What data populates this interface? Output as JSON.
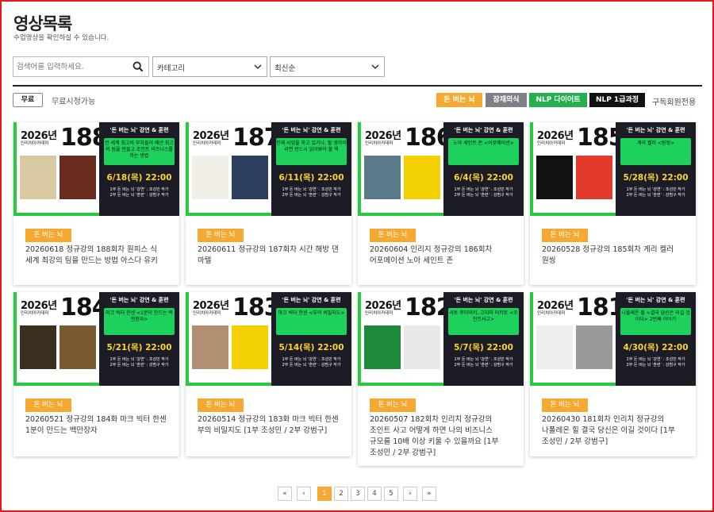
{
  "page": {
    "title": "영상목록",
    "subtitle": "수업영상을 확인하실 수 있습니다."
  },
  "search": {
    "placeholder": "검색어를 입력하세요.",
    "category": "카테고리",
    "sort": "최신순"
  },
  "filters": {
    "free_button": "무료",
    "free_label": "무료시청가능",
    "tags": [
      {
        "label": "돈 버는 뇌",
        "color": "#f5a930"
      },
      {
        "label": "잠재의식",
        "color": "#7d8087"
      },
      {
        "label": "NLP 다이어트",
        "color": "#22b14c"
      },
      {
        "label": "NLP 1급과정",
        "color": "#111111"
      }
    ],
    "subscriber_label": "구독회원전용"
  },
  "thumb_common": {
    "year": "2026년",
    "academy": "인리치아카데미",
    "heading": "'돈 버는 뇌' 강연 & 훈련",
    "time_prefix": "",
    "session_line1": "1부 돈 버는 뇌 '강연' : 조성민 작가",
    "session_line2": "2부 돈 버는 뇌 '훈련' : 강범구 작가"
  },
  "cards": [
    {
      "num": "188",
      "green_text": "전 세계 최고의 부자들이 매년 최고의 팀을 만들고 조인트 비즈니스를 하는 방법",
      "date": "6/18(목) 22:00",
      "badge": "돈 버는 뇌",
      "title": "20260618 정규강의 188회차 원피스 식 세계 최강의 팀을 만드는 방법 아스다 유키"
    },
    {
      "num": "187",
      "green_text": "천재 사업을 하고 있거나, 할 생각이라면 반드시 읽어봐야 할 책",
      "date": "6/11(목) 22:00",
      "badge": "돈 버는 뇌",
      "title": "20260611 정규강의 187회차 시간 해방 댄 마텔"
    },
    {
      "num": "186",
      "green_text": "노아 세인트 존 <어포메이션>",
      "date": "6/4(목) 22:00",
      "badge": "돈 버는 뇌",
      "title": "20260604 인리지 정규강의 186회차 어포메이션 노아 세인트 존"
    },
    {
      "num": "185",
      "green_text": "게리 켈러 <원씽>",
      "date": "5/28(목) 22:00",
      "badge": "돈 버는 뇌",
      "title": "20260528 정규강의 185회차 게리 켈러 원씽"
    },
    {
      "num": "184",
      "green_text": "마크 빅터 한센 <1분이 만드는 백만장자>",
      "date": "5/21(목) 22:00",
      "badge": "돈 버는 뇌",
      "title": "20260521 정규강의 184화 마크 빅터 한센 1분이 만드는 백만장자"
    },
    {
      "num": "183",
      "green_text": "마크 빅터 한센 <부의 비밀지도>",
      "date": "5/14(목) 22:00",
      "badge": "돈 버는 뇌",
      "title": "20260514 정규강의 183화 마크 빅터 한센 부의 비밀지도 [1부 조성민 / 2부 강범구]"
    },
    {
      "num": "182",
      "green_text": "사토 후미아키, 고지마 미키토 <조인트사고>",
      "date": "5/7(목) 22:00",
      "badge": "돈 버는 뇌",
      "title": "20260507 182회차 인리치 정규강의 조인트 사고 어떻게 하면 나의 비즈니스 규모를 10배 이상 키울 수 있을까요 [1부 조성민 / 2부 강범구]"
    },
    {
      "num": "181",
      "green_text": "나폴레온 힐 <결국 당신은 이길 것이다> 2번째 이야기",
      "date": "4/30(목) 22:00",
      "badge": "돈 버는 뇌",
      "title": "20260430 181회차 인리치 정규강의 나폴레온 힐 결국 당신은 이길 것이다 [1부 조성민 / 2부 강범구]"
    }
  ],
  "pagination": {
    "first": "«",
    "prev": "‹",
    "pages": [
      "1",
      "2",
      "3",
      "4",
      "5"
    ],
    "active": "1",
    "next": "›",
    "last": "»"
  }
}
